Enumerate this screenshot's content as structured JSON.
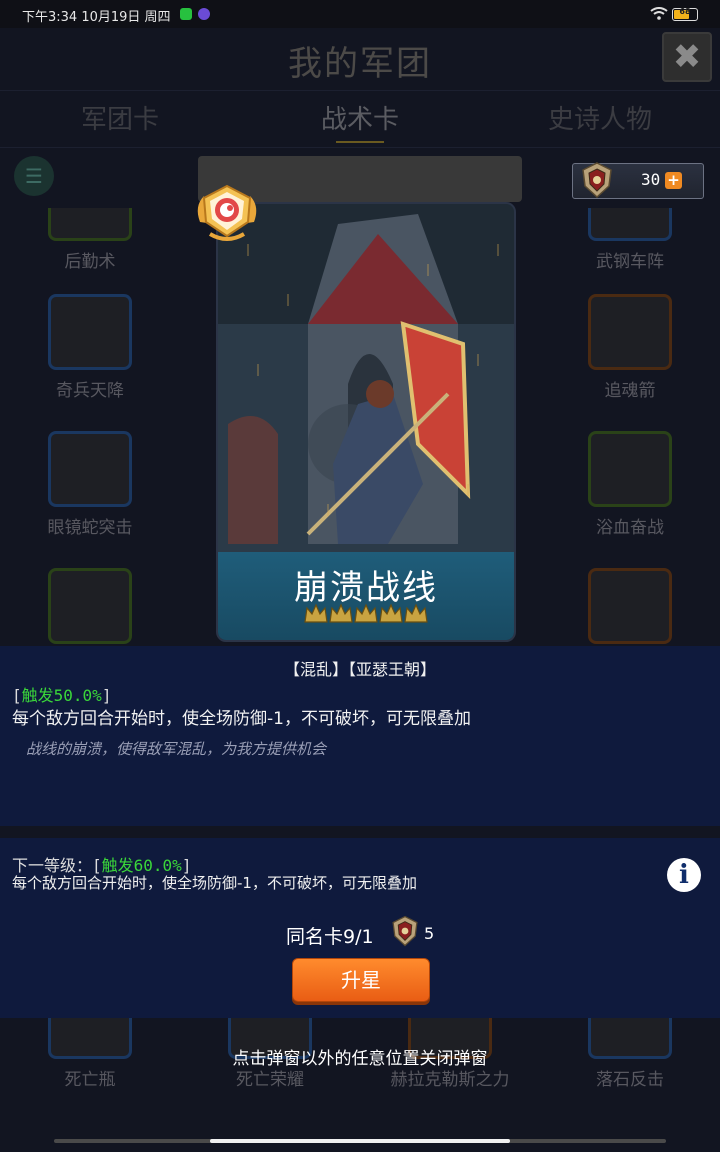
{
  "status_bar": {
    "time": "下午3:34 10月19日 周四",
    "battery": "68"
  },
  "background": {
    "title": "我的军团",
    "close_label": "✖",
    "tabs": [
      "军团卡",
      "战术卡",
      "史诗人物"
    ],
    "active_tab": "战术卡",
    "grid_labels": {
      "r0c0": "后勤术",
      "r0c3": "武钢车阵",
      "r1c0": "奇兵天降",
      "r1c3": "追魂箭",
      "r2c0": "眼镜蛇突击",
      "r2c3": "浴血奋战",
      "r6c0": "死亡瓶",
      "r6c1": "死亡荣耀",
      "r6c2": "赫拉克勒斯之力",
      "r6c3": "落石反击"
    }
  },
  "currency": {
    "count": "30",
    "plus": "+"
  },
  "card": {
    "name": "崩溃战线",
    "stars": 5,
    "tags": "【混乱】【亚瑟王朝】",
    "trigger_prefix": "[",
    "trigger_value": "触发50.0%",
    "trigger_suffix": "]",
    "effect": "每个敌方回合开始时，使全场防御-1，不可破坏，可无限叠加",
    "flavor": "战线的崩溃，使得敌军混乱，为我方提供机会"
  },
  "next_level": {
    "prefix": "下一等级：[",
    "trigger_value": "触发60.0%",
    "suffix": "]",
    "effect": "每个敌方回合开始时，使全场防御-1，不可破坏，可无限叠加",
    "info_label": "i"
  },
  "duplicates": {
    "label": "同名卡9/1",
    "crest_count": "5"
  },
  "upgrade_label": "升星",
  "close_hint": "点击弹窗以外的任意位置关闭弹窗",
  "colors": {
    "panel": "#0f1a3d",
    "trigger_green": "#3ad63a",
    "upgrade_orange": "#f07a22",
    "badge_gold": "#f0b23a",
    "badge_red": "#e84a4a"
  }
}
